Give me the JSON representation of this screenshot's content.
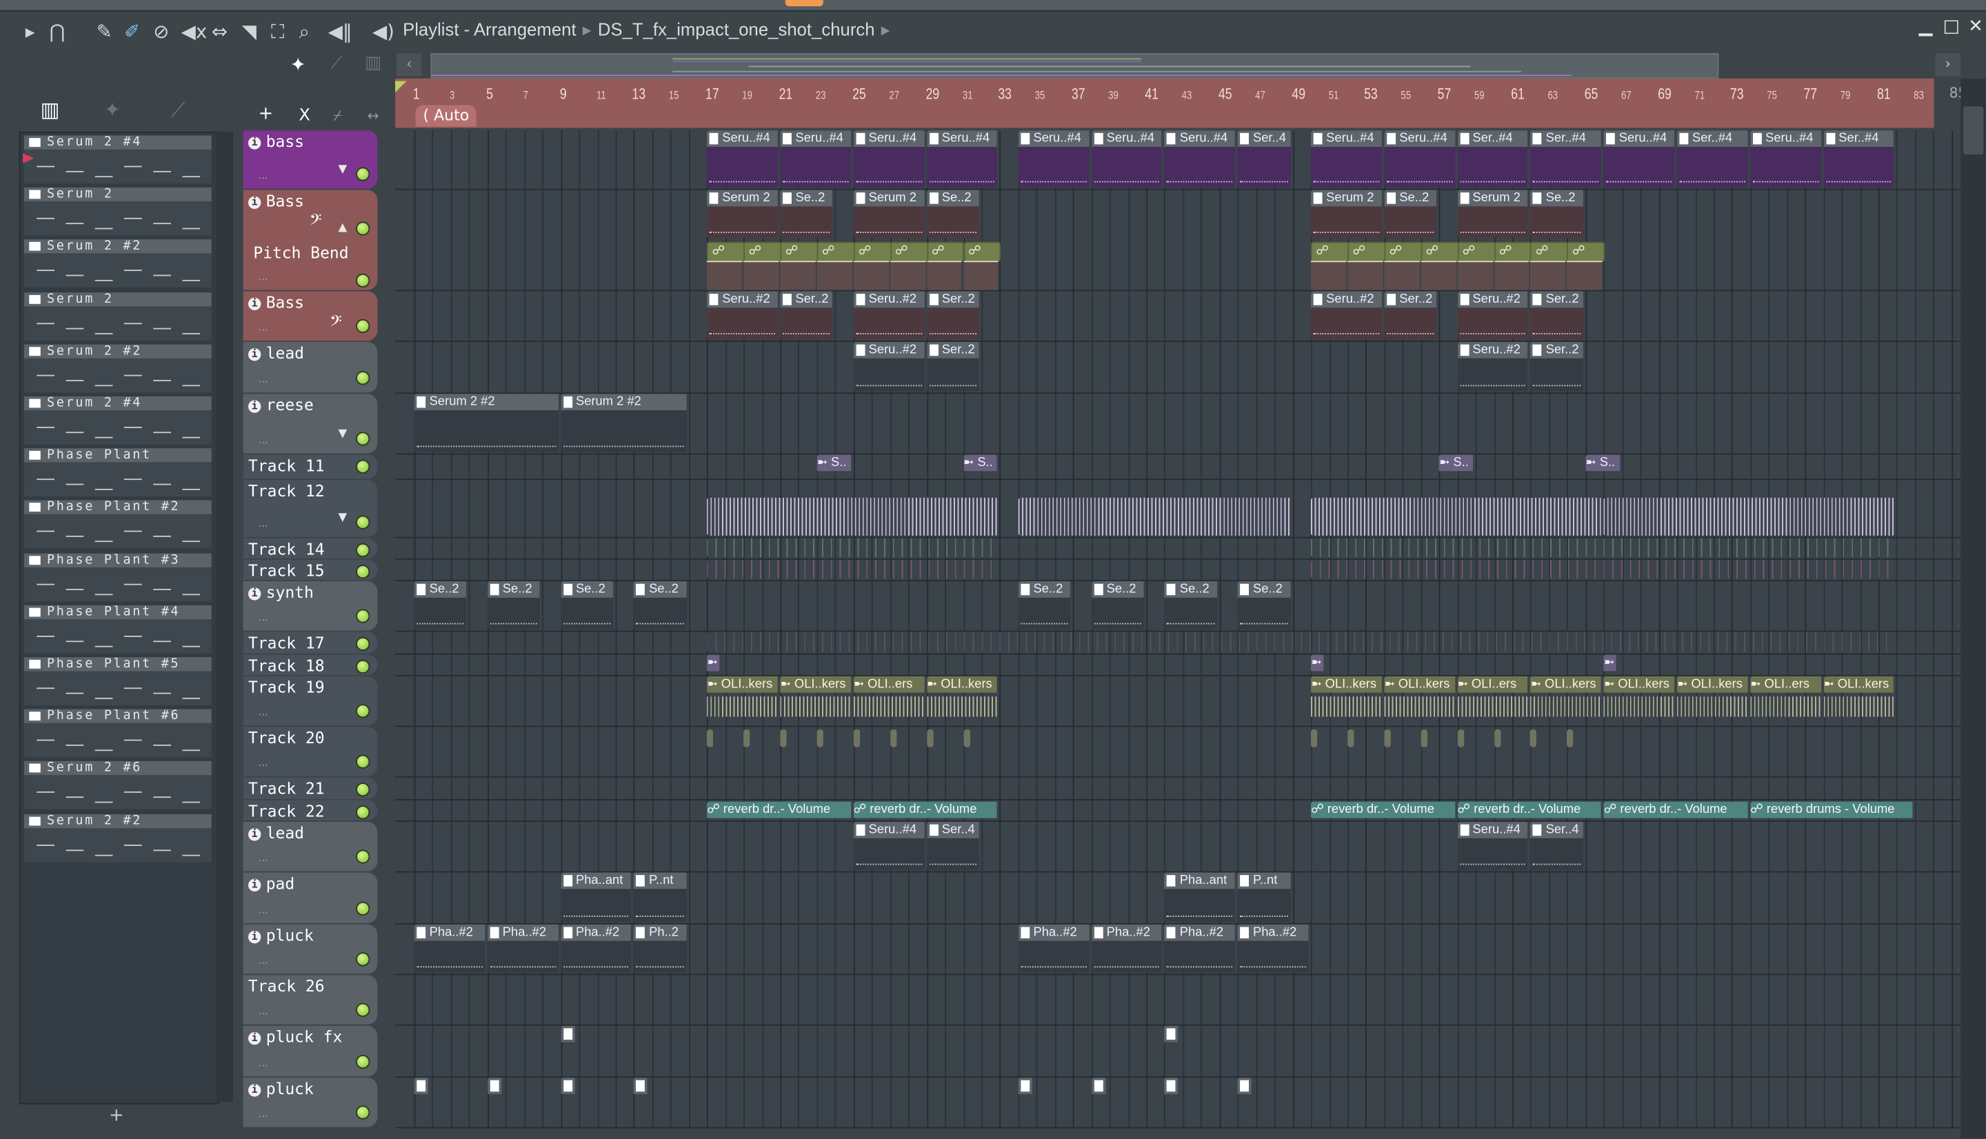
{
  "window": {
    "title": "Playlist - Arrangement",
    "breadcrumb": "DS_T_fx_impact_one_shot_church",
    "minimize": "▁",
    "maximize": "□",
    "close": "✕"
  },
  "toolbar_icons": [
    "play-arrow-icon",
    "magnet-snap-icon",
    "pencil-draw-icon",
    "paint-brush-icon",
    "delete-icon",
    "mute-icon",
    "slip-icon",
    "slice-icon",
    "select-icon",
    "zoom-icon",
    "playback-icon",
    "speaker-icon"
  ],
  "ruler": {
    "auto_label": "( Auto",
    "bars": [
      1,
      3,
      5,
      7,
      9,
      11,
      13,
      15,
      17,
      19,
      21,
      23,
      25,
      27,
      29,
      31,
      33,
      35,
      37,
      39,
      41,
      43,
      45,
      47,
      49,
      51,
      53,
      55,
      57,
      59,
      61,
      63,
      65,
      67,
      69,
      71,
      73,
      75,
      77,
      79,
      81,
      83
    ],
    "partial": "85"
  },
  "picker": {
    "add_label": "+",
    "items": [
      {
        "label": "Serum 2 #4"
      },
      {
        "label": "Serum 2"
      },
      {
        "label": "Serum 2 #2"
      },
      {
        "label": "Serum 2"
      },
      {
        "label": "Serum 2 #2"
      },
      {
        "label": "Serum 2 #4"
      },
      {
        "label": "Phase Plant"
      },
      {
        "label": "Phase Plant #2"
      },
      {
        "label": "Phase Plant #3"
      },
      {
        "label": "Phase Plant #4"
      },
      {
        "label": "Phase Plant #5"
      },
      {
        "label": "Phase Plant #6"
      },
      {
        "label": "Serum 2 #6"
      },
      {
        "label": "Serum 2 #2"
      }
    ]
  },
  "header_tools": {
    "add": "+",
    "cut": "X",
    "curve": "⌿",
    "link": "↔"
  },
  "tracks": [
    {
      "name": "bass",
      "color": "purple",
      "info": true,
      "dd": true,
      "clips": [
        {
          "s": 17,
          "l": 4,
          "t": "Seru..#4"
        },
        {
          "s": 21,
          "l": 4,
          "t": "Seru..#4"
        },
        {
          "s": 25,
          "l": 4,
          "t": "Seru..#4"
        },
        {
          "s": 29,
          "l": 4,
          "t": "Seru..#4"
        },
        {
          "s": 34,
          "l": 4,
          "t": "Seru..#4"
        },
        {
          "s": 38,
          "l": 4,
          "t": "Seru..#4"
        },
        {
          "s": 42,
          "l": 4,
          "t": "Seru..#4"
        },
        {
          "s": 46,
          "l": 3,
          "t": "Ser..4"
        },
        {
          "s": 50,
          "l": 4,
          "t": "Seru..#4"
        },
        {
          "s": 54,
          "l": 4,
          "t": "Seru..#4"
        },
        {
          "s": 58,
          "l": 4,
          "t": "Ser..#4"
        },
        {
          "s": 62,
          "l": 4,
          "t": "Ser..#4"
        },
        {
          "s": 66,
          "l": 4,
          "t": "Seru..#4"
        },
        {
          "s": 70,
          "l": 4,
          "t": "Ser..#4"
        },
        {
          "s": 74,
          "l": 4,
          "t": "Seru..#4"
        },
        {
          "s": 78,
          "l": 4,
          "t": "Ser..#4"
        }
      ]
    },
    {
      "name": "Bass",
      "color": "red",
      "info": true,
      "clef": "up",
      "sub": "Pitch Bend",
      "clips": [
        {
          "s": 17,
          "l": 4,
          "t": "Serum 2"
        },
        {
          "s": 21,
          "l": 3,
          "t": "Se..2"
        },
        {
          "s": 25,
          "l": 4,
          "t": "Serum 2"
        },
        {
          "s": 29,
          "l": 3,
          "t": "Se..2"
        },
        {
          "s": 50,
          "l": 4,
          "t": "Serum 2"
        },
        {
          "s": 54,
          "l": 3,
          "t": "Se..2"
        },
        {
          "s": 58,
          "l": 4,
          "t": "Serum 2"
        },
        {
          "s": 62,
          "l": 3,
          "t": "Se..2"
        },
        {
          "s": 17,
          "l": 2,
          "k": "auto",
          "lane": 1
        },
        {
          "s": 19,
          "l": 2,
          "k": "auto",
          "lane": 1
        },
        {
          "s": 21,
          "l": 2,
          "k": "auto",
          "lane": 1
        },
        {
          "s": 23,
          "l": 2,
          "k": "auto",
          "lane": 1
        },
        {
          "s": 25,
          "l": 2,
          "k": "auto",
          "lane": 1
        },
        {
          "s": 27,
          "l": 2,
          "k": "auto",
          "lane": 1
        },
        {
          "s": 29,
          "l": 2,
          "k": "auto",
          "lane": 1
        },
        {
          "s": 31,
          "l": 2,
          "k": "auto",
          "lane": 1
        },
        {
          "s": 50,
          "l": 2,
          "k": "auto",
          "lane": 1
        },
        {
          "s": 52,
          "l": 2,
          "k": "auto",
          "lane": 1
        },
        {
          "s": 54,
          "l": 2,
          "k": "auto",
          "lane": 1
        },
        {
          "s": 56,
          "l": 2,
          "k": "auto",
          "lane": 1
        },
        {
          "s": 58,
          "l": 2,
          "k": "auto",
          "lane": 1
        },
        {
          "s": 60,
          "l": 2,
          "k": "auto",
          "lane": 1
        },
        {
          "s": 62,
          "l": 2,
          "k": "auto",
          "lane": 1
        },
        {
          "s": 64,
          "l": 2,
          "k": "auto",
          "lane": 1
        }
      ]
    },
    {
      "name": "Bass",
      "color": "red",
      "info": true,
      "clef": "plain",
      "clips": [
        {
          "s": 17,
          "l": 4,
          "t": "Seru..#2"
        },
        {
          "s": 21,
          "l": 3,
          "t": "Ser..2"
        },
        {
          "s": 25,
          "l": 4,
          "t": "Seru..#2"
        },
        {
          "s": 29,
          "l": 3,
          "t": "Ser..2"
        },
        {
          "s": 50,
          "l": 4,
          "t": "Seru..#2"
        },
        {
          "s": 54,
          "l": 3,
          "t": "Ser..2"
        },
        {
          "s": 58,
          "l": 4,
          "t": "Seru..#2"
        },
        {
          "s": 62,
          "l": 3,
          "t": "Ser..2"
        }
      ]
    },
    {
      "name": "lead",
      "color": "gray",
      "info": true,
      "clips": [
        {
          "s": 25,
          "l": 4,
          "t": "Seru..#2"
        },
        {
          "s": 29,
          "l": 3,
          "t": "Ser..2"
        },
        {
          "s": 58,
          "l": 4,
          "t": "Seru..#2"
        },
        {
          "s": 62,
          "l": 3,
          "t": "Ser..2"
        }
      ]
    },
    {
      "name": "reese",
      "color": "gray",
      "info": true,
      "dd": true,
      "clips": [
        {
          "s": 1,
          "l": 8,
          "t": "Serum 2 #2"
        },
        {
          "s": 9,
          "l": 7,
          "t": "Serum 2 #2"
        }
      ]
    },
    {
      "name": "Track 11",
      "color": "dark",
      "clips": [
        {
          "s": 23,
          "l": 2,
          "t": "S..",
          "k": "audiohdr"
        },
        {
          "s": 31,
          "l": 2,
          "t": "S..",
          "k": "audiohdr"
        },
        {
          "s": 57,
          "l": 2,
          "t": "S..",
          "k": "audiohdr"
        },
        {
          "s": 65,
          "l": 2,
          "t": "S..",
          "k": "audiohdr"
        }
      ]
    },
    {
      "name": "Track 12",
      "color": "dark",
      "dd": true,
      "clips": [
        {
          "s": 17,
          "l": 16,
          "k": "wave"
        },
        {
          "s": 34,
          "l": 15,
          "k": "wave"
        },
        {
          "s": 50,
          "l": 16,
          "k": "wave"
        },
        {
          "s": 66,
          "l": 16,
          "k": "wave"
        }
      ]
    },
    {
      "name": "Track 14",
      "color": "dark",
      "clips": [
        {
          "s": 17,
          "l": 16,
          "k": "lines",
          "c": "#6d8a7e"
        },
        {
          "s": 50,
          "l": 32,
          "k": "lines",
          "c": "#6d8a7e"
        }
      ]
    },
    {
      "name": "Track 15",
      "color": "dark",
      "clips": [
        {
          "s": 17,
          "l": 16,
          "k": "lines",
          "c": "#8a6478"
        },
        {
          "s": 50,
          "l": 32,
          "k": "lines",
          "c": "#8a6478"
        }
      ]
    },
    {
      "name": "synth",
      "color": "gray",
      "info": true,
      "clips": [
        {
          "s": 1,
          "l": 3,
          "t": "Se..2"
        },
        {
          "s": 5,
          "l": 3,
          "t": "Se..2"
        },
        {
          "s": 9,
          "l": 3,
          "t": "Se..2"
        },
        {
          "s": 13,
          "l": 3,
          "t": "Se..2"
        },
        {
          "s": 34,
          "l": 3,
          "t": "Se..2"
        },
        {
          "s": 38,
          "l": 3,
          "t": "Se..2"
        },
        {
          "s": 42,
          "l": 3,
          "t": "Se..2"
        },
        {
          "s": 46,
          "l": 3,
          "t": "Se..2"
        }
      ]
    },
    {
      "name": "Track 17",
      "color": "dark",
      "clips": [
        {
          "s": 17,
          "l": 65,
          "k": "lines",
          "c": "#6a5560"
        }
      ]
    },
    {
      "name": "Track 18",
      "color": "dark",
      "clips": [
        {
          "s": 17,
          "l": 0.8,
          "t": "",
          "k": "audiohdr"
        },
        {
          "s": 50,
          "l": 0.8,
          "t": "",
          "k": "audiohdr"
        },
        {
          "s": 66,
          "l": 0.8,
          "t": "",
          "k": "audiohdr"
        }
      ]
    },
    {
      "name": "Track 19",
      "color": "dark",
      "clips": [
        {
          "s": 17,
          "l": 4,
          "t": "OLI..kers",
          "k": "olive"
        },
        {
          "s": 21,
          "l": 4,
          "t": "OLI..kers",
          "k": "olive"
        },
        {
          "s": 25,
          "l": 4,
          "t": "OLI..ers",
          "k": "olive"
        },
        {
          "s": 29,
          "l": 4,
          "t": "OLI..kers",
          "k": "olive"
        },
        {
          "s": 50,
          "l": 4,
          "t": "OLI..kers",
          "k": "olive"
        },
        {
          "s": 54,
          "l": 4,
          "t": "OLI..kers",
          "k": "olive"
        },
        {
          "s": 58,
          "l": 4,
          "t": "OLI..ers",
          "k": "olive"
        },
        {
          "s": 62,
          "l": 4,
          "t": "OLI..kers",
          "k": "olive"
        },
        {
          "s": 66,
          "l": 4,
          "t": "OLI..kers",
          "k": "olive"
        },
        {
          "s": 70,
          "l": 4,
          "t": "OLI..kers",
          "k": "olive"
        },
        {
          "s": 74,
          "l": 4,
          "t": "OLI..ers",
          "k": "olive"
        },
        {
          "s": 78,
          "l": 4,
          "t": "OLI..kers",
          "k": "olive"
        }
      ]
    },
    {
      "name": "Track 20",
      "color": "dark",
      "clips": [
        {
          "s": 17,
          "l": 0.5,
          "k": "tick"
        },
        {
          "s": 19,
          "l": 0.5,
          "k": "tick"
        },
        {
          "s": 21,
          "l": 0.5,
          "k": "tick"
        },
        {
          "s": 23,
          "l": 0.5,
          "k": "tick"
        },
        {
          "s": 25,
          "l": 0.5,
          "k": "tick"
        },
        {
          "s": 27,
          "l": 0.5,
          "k": "tick"
        },
        {
          "s": 29,
          "l": 0.5,
          "k": "tick"
        },
        {
          "s": 31,
          "l": 0.5,
          "k": "tick"
        },
        {
          "s": 50,
          "l": 0.5,
          "k": "tick"
        },
        {
          "s": 52,
          "l": 0.5,
          "k": "tick"
        },
        {
          "s": 54,
          "l": 0.5,
          "k": "tick"
        },
        {
          "s": 56,
          "l": 0.5,
          "k": "tick"
        },
        {
          "s": 58,
          "l": 0.5,
          "k": "tick"
        },
        {
          "s": 60,
          "l": 0.5,
          "k": "tick"
        },
        {
          "s": 62,
          "l": 0.5,
          "k": "tick"
        },
        {
          "s": 64,
          "l": 0.5,
          "k": "tick"
        }
      ]
    },
    {
      "name": "Track 21",
      "color": "dark",
      "clips": []
    },
    {
      "name": "Track 22",
      "color": "dark",
      "clips": [
        {
          "s": 17,
          "l": 8,
          "t": "reverb dr..- Volume",
          "k": "teal"
        },
        {
          "s": 25,
          "l": 8,
          "t": "reverb dr..- Volume",
          "k": "teal"
        },
        {
          "s": 50,
          "l": 8,
          "t": "reverb dr..- Volume",
          "k": "teal"
        },
        {
          "s": 58,
          "l": 8,
          "t": "reverb dr..- Volume",
          "k": "teal"
        },
        {
          "s": 66,
          "l": 8,
          "t": "reverb dr..- Volume",
          "k": "teal"
        },
        {
          "s": 74,
          "l": 9,
          "t": "reverb drums - Volume",
          "k": "teal"
        }
      ]
    },
    {
      "name": "lead",
      "color": "gray",
      "info": true,
      "clips": [
        {
          "s": 25,
          "l": 4,
          "t": "Seru..#4"
        },
        {
          "s": 29,
          "l": 3,
          "t": "Ser..4"
        },
        {
          "s": 58,
          "l": 4,
          "t": "Seru..#4"
        },
        {
          "s": 62,
          "l": 3,
          "t": "Ser..4"
        }
      ]
    },
    {
      "name": "pad",
      "color": "gray",
      "info": true,
      "clips": [
        {
          "s": 9,
          "l": 4,
          "t": "Pha..ant"
        },
        {
          "s": 13,
          "l": 3,
          "t": "P..nt"
        },
        {
          "s": 42,
          "l": 4,
          "t": "Pha..ant"
        },
        {
          "s": 46,
          "l": 3,
          "t": "P..nt"
        }
      ]
    },
    {
      "name": "pluck",
      "color": "gray",
      "info": true,
      "clips": [
        {
          "s": 1,
          "l": 4,
          "t": "Pha..#2"
        },
        {
          "s": 5,
          "l": 4,
          "t": "Pha..#2"
        },
        {
          "s": 9,
          "l": 4,
          "t": "Pha..#2"
        },
        {
          "s": 13,
          "l": 3,
          "t": "Ph..2"
        },
        {
          "s": 34,
          "l": 4,
          "t": "Pha..#2"
        },
        {
          "s": 38,
          "l": 4,
          "t": "Pha..#2"
        },
        {
          "s": 42,
          "l": 4,
          "t": "Pha..#2"
        },
        {
          "s": 46,
          "l": 4,
          "t": "Pha..#2"
        }
      ]
    },
    {
      "name": "Track 26",
      "color": "gray",
      "clips": []
    },
    {
      "name": "pluck fx",
      "color": "gray",
      "info": true,
      "clips": [
        {
          "s": 9,
          "l": 1,
          "t": "",
          "k": "mini"
        },
        {
          "s": 42,
          "l": 1,
          "t": "",
          "k": "mini"
        }
      ]
    },
    {
      "name": "pluck",
      "color": "gray",
      "info": true,
      "clips": [
        {
          "s": 1,
          "l": 1,
          "t": "",
          "k": "mini"
        },
        {
          "s": 5,
          "l": 1,
          "t": "",
          "k": "mini"
        },
        {
          "s": 9,
          "l": 1,
          "t": "",
          "k": "mini"
        },
        {
          "s": 13,
          "l": 1,
          "t": "",
          "k": "mini"
        },
        {
          "s": 34,
          "l": 1,
          "t": "",
          "k": "mini"
        },
        {
          "s": 38,
          "l": 1,
          "t": "",
          "k": "mini"
        },
        {
          "s": 42,
          "l": 1,
          "t": "",
          "k": "mini"
        },
        {
          "s": 46,
          "l": 1,
          "t": "",
          "k": "mini"
        }
      ]
    }
  ],
  "colors": {
    "ruler": "#955a5a",
    "purple": "#7d3590",
    "red": "#8e5858",
    "grid": "#3b434b",
    "led": "#8fd040"
  }
}
